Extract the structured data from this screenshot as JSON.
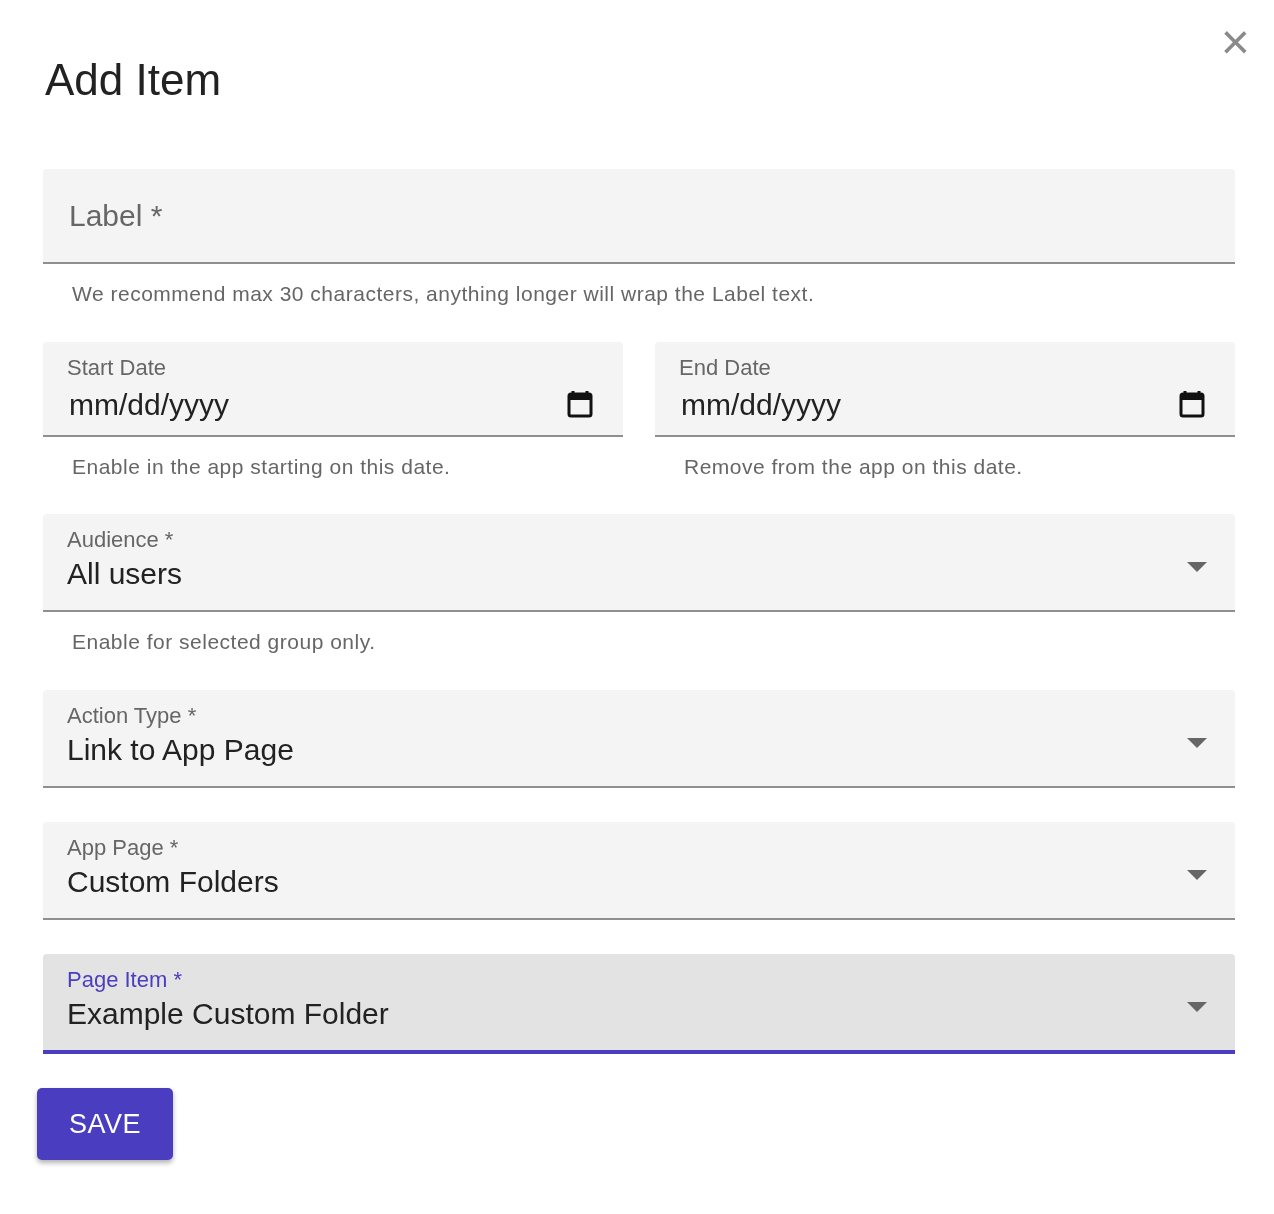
{
  "dialog": {
    "title": "Add Item",
    "close": "×"
  },
  "rows": [
    {
      "fields": [
        {
          "kind": "text",
          "placeholder": "Label *",
          "helper": "We recommend max 30 characters, anything longer will wrap the Label text.",
          "focused": false
        }
      ]
    },
    {
      "fields": [
        {
          "kind": "date",
          "label": "Start Date",
          "placeholder": "mm/dd/yyyy",
          "helper": "Enable in the app starting on this date.",
          "focused": false
        },
        {
          "kind": "date",
          "label": "End Date",
          "placeholder": "mm/dd/yyyy",
          "helper": "Remove from the app on this date.",
          "focused": false
        }
      ]
    },
    {
      "fields": [
        {
          "kind": "select",
          "label": "Audience *",
          "value": "All users",
          "helper": "Enable for selected group only.",
          "focused": false
        }
      ]
    },
    {
      "fields": [
        {
          "kind": "select",
          "label": "Action Type *",
          "value": "Link to App Page",
          "focused": false
        }
      ]
    },
    {
      "fields": [
        {
          "kind": "select",
          "label": "App Page *",
          "value": "Custom Folders",
          "focused": false
        }
      ]
    },
    {
      "fields": [
        {
          "kind": "select",
          "label": "Page Item *",
          "value": "Example Custom Folder",
          "focused": true
        }
      ]
    }
  ],
  "save_button": "SAVE"
}
